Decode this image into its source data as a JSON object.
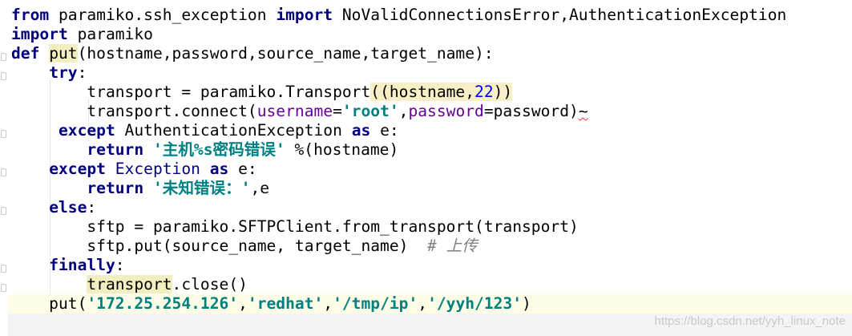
{
  "editor": {
    "language": "python",
    "lines": [
      {
        "t": [
          [
            "from",
            "kw"
          ],
          [
            " paramiko.ssh_exception ",
            ""
          ],
          [
            "import",
            "kw"
          ],
          [
            " NoValidConnectionsError,AuthenticationException",
            ""
          ]
        ]
      },
      {
        "t": [
          [
            "import",
            "kw"
          ],
          [
            " paramiko",
            ""
          ]
        ]
      },
      {
        "t": [
          [
            "def",
            "kw"
          ],
          [
            " ",
            ""
          ],
          [
            "put",
            "hlword"
          ],
          [
            "(hostname,password,source_name,target_name):",
            ""
          ]
        ]
      },
      {
        "t": [
          [
            "    ",
            ""
          ],
          [
            "try",
            "kw"
          ],
          [
            ":",
            ""
          ]
        ]
      },
      {
        "t": [
          [
            "        transport = paramiko.Transport",
            ""
          ],
          [
            "(",
            "hlparen"
          ],
          [
            "(hostname,",
            "hlparen"
          ],
          [
            "22",
            "num hlparen"
          ],
          [
            ")",
            "hlparen"
          ],
          [
            ")",
            "hlparen"
          ]
        ]
      },
      {
        "t": [
          [
            "        transport.connect(",
            ""
          ],
          [
            "username",
            "param"
          ],
          [
            "=",
            ""
          ],
          [
            "'root'",
            "str"
          ],
          [
            ",",
            ""
          ],
          [
            "password",
            "param"
          ],
          [
            "=password)",
            ""
          ],
          [
            "~",
            "squiggle"
          ]
        ]
      },
      {
        "t": [
          [
            "     ",
            ""
          ],
          [
            "except",
            "kw"
          ],
          [
            " AuthenticationException ",
            ""
          ],
          [
            "as",
            "kw"
          ],
          [
            " e:",
            ""
          ]
        ]
      },
      {
        "t": [
          [
            "        ",
            ""
          ],
          [
            "return",
            "kw"
          ],
          [
            " ",
            ""
          ],
          [
            "'主机%s密码错误'",
            "str"
          ],
          [
            " %(hostname)",
            ""
          ]
        ]
      },
      {
        "t": [
          [
            "    ",
            ""
          ],
          [
            "except",
            "kw"
          ],
          [
            " ",
            ""
          ],
          [
            "Exception",
            "builtin"
          ],
          [
            " ",
            ""
          ],
          [
            "as",
            "kw"
          ],
          [
            " e:",
            ""
          ]
        ]
      },
      {
        "t": [
          [
            "        ",
            ""
          ],
          [
            "return",
            "kw"
          ],
          [
            " ",
            ""
          ],
          [
            "'未知错误：'",
            "str"
          ],
          [
            ",e",
            ""
          ]
        ]
      },
      {
        "t": [
          [
            "    ",
            ""
          ],
          [
            "else",
            "kw"
          ],
          [
            ":",
            ""
          ]
        ]
      },
      {
        "t": [
          [
            "        sftp = paramiko.SFTPClient.from_transport(transport)",
            ""
          ]
        ]
      },
      {
        "t": [
          [
            "        sftp.put(source_name, target_name)  ",
            ""
          ],
          [
            "# 上传",
            "cmt"
          ]
        ]
      },
      {
        "t": [
          [
            "    ",
            ""
          ],
          [
            "finally",
            "kw"
          ],
          [
            ":",
            ""
          ]
        ]
      },
      {
        "t": [
          [
            "        ",
            ""
          ],
          [
            "transport",
            "hlword"
          ],
          [
            ".close()",
            ""
          ]
        ]
      },
      {
        "t": [
          [
            "    put(",
            ""
          ],
          [
            "'172.25.254.126'",
            "str"
          ],
          [
            ",",
            ""
          ],
          [
            "'redhat'",
            "str"
          ],
          [
            ",",
            ""
          ],
          [
            "'/tmp/ip'",
            "str"
          ],
          [
            ",",
            ""
          ],
          [
            "'/yyh/123'",
            "str"
          ],
          [
            ")",
            ""
          ]
        ]
      }
    ]
  },
  "watermark": "https://blog.csdn.net/yyh_linux_note"
}
